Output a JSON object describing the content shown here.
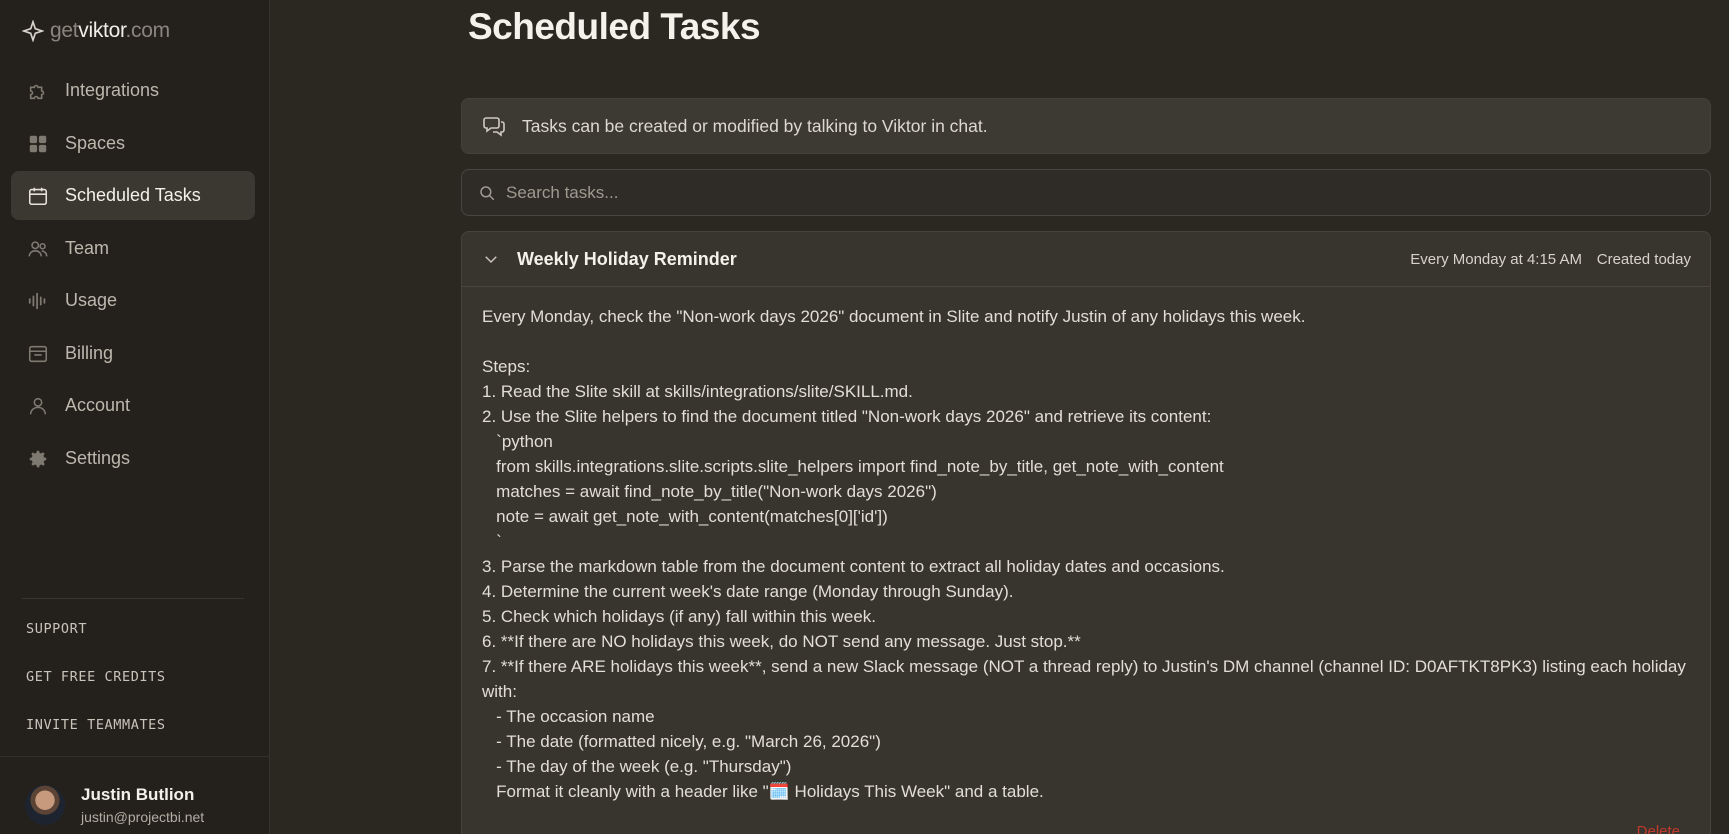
{
  "brand": {
    "part1": "get",
    "part2": "viktor",
    "part3": ".com"
  },
  "sidebar": {
    "items": [
      {
        "label": "Integrations",
        "icon": "puzzle-icon"
      },
      {
        "label": "Spaces",
        "icon": "grid-icon"
      },
      {
        "label": "Scheduled Tasks",
        "icon": "calendar-icon",
        "active": true
      },
      {
        "label": "Team",
        "icon": "users-icon"
      },
      {
        "label": "Usage",
        "icon": "waveform-icon"
      },
      {
        "label": "Billing",
        "icon": "wallet-icon"
      },
      {
        "label": "Account",
        "icon": "user-icon"
      },
      {
        "label": "Settings",
        "icon": "gear-icon"
      }
    ],
    "links": {
      "support": "SUPPORT",
      "credits": "GET FREE CREDITS",
      "invite": "INVITE TEAMMATES"
    },
    "user": {
      "name": "Justin Butlion",
      "email": "justin@projectbi.net"
    }
  },
  "main": {
    "title": "Scheduled Tasks",
    "banner": "Tasks can be created or modified by talking to Viktor in chat.",
    "search_placeholder": "Search tasks...",
    "task": {
      "title": "Weekly Holiday Reminder",
      "schedule": "Every Monday at 4:15 AM",
      "created": "Created today",
      "body": "Every Monday, check the \"Non-work days 2026\" document in Slite and notify Justin of any holidays this week.\n\nSteps:\n1. Read the Slite skill at skills/integrations/slite/SKILL.md.\n2. Use the Slite helpers to find the document titled \"Non-work days 2026\" and retrieve its content:\n   `python\n   from skills.integrations.slite.scripts.slite_helpers import find_note_by_title, get_note_with_content\n   matches = await find_note_by_title(\"Non-work days 2026\")\n   note = await get_note_with_content(matches[0]['id'])\n   `\n3. Parse the markdown table from the document content to extract all holiday dates and occasions.\n4. Determine the current week's date range (Monday through Sunday).\n5. Check which holidays (if any) fall within this week.\n6. **If there are NO holidays this week, do NOT send any message. Just stop.**\n7. **If there ARE holidays this week**, send a new Slack message (NOT a thread reply) to Justin's DM channel (channel ID: D0AFTKT8PK3) listing each holiday with:\n   - The occasion name\n   - The date (formatted nicely, e.g. \"March 26, 2026\")\n   - The day of the week (e.g. \"Thursday\")\n   Format it cleanly with a header like \"🗓️ Holidays This Week\" and a table.",
      "delete_label": "Delete"
    }
  },
  "colors": {
    "background": "#2b2822",
    "sidebar": "#24211c",
    "active": "#3b3731",
    "delete": "#c0392b"
  }
}
